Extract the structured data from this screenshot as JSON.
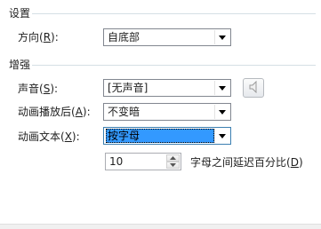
{
  "settings": {
    "title": "设置",
    "direction": {
      "label_pre": "方向(",
      "accel": "R",
      "label_post": "):",
      "value": "自底部"
    }
  },
  "enhance": {
    "title": "增强",
    "sound": {
      "label_pre": "声音(",
      "accel": "S",
      "label_post": "):",
      "value": "[无声音]"
    },
    "after_animation": {
      "label_pre": "动画播放后(",
      "accel": "A",
      "label_post": "):",
      "value": "不变暗"
    },
    "animate_text": {
      "label_pre": "动画文本(",
      "accel": "X",
      "label_post": "):",
      "value": "按字母"
    },
    "delay": {
      "value": "10",
      "label_pre": "字母之间延迟百分比(",
      "accel": "D",
      "label_post": ")"
    }
  },
  "icons": {
    "dropdown": "chevron-down-icon",
    "sound_button": "speaker-icon",
    "spin_up": "spin-up-icon",
    "spin_down": "spin-down-icon"
  },
  "colors": {
    "focus_highlight": "#3399ff",
    "group_line": "#d5dfe5",
    "border": "#828790"
  }
}
